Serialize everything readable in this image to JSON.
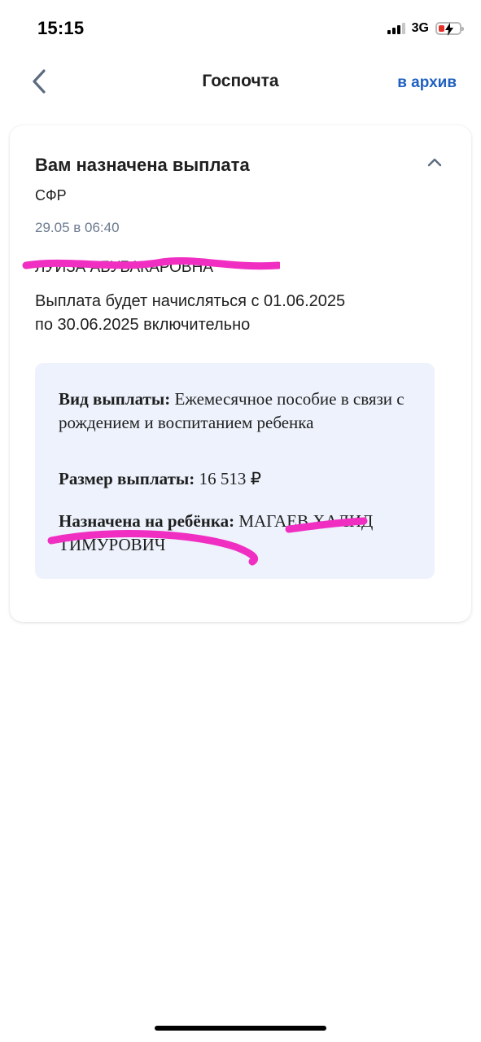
{
  "status_bar": {
    "time": "15:15",
    "network": "3G",
    "signal_bars": 4,
    "signal_bars_active": 3,
    "battery_level": 0.15,
    "battery_charging": true,
    "battery_color": "#e4322b"
  },
  "nav": {
    "back_icon": "chevron-left-icon",
    "title": "Госпочта",
    "archive_label": "в архив",
    "accent_color": "#1f5fbf"
  },
  "message": {
    "title": "Вам назначена выплата",
    "collapse_icon": "chevron-up-icon",
    "sender": "СФР",
    "datetime": "29.05 в 06:40",
    "recipient_name": "ЛУИЗА АБУБАКАРОВНА",
    "period_line1": "Выплата будет начисляться с 01.06.2025",
    "period_line2": "по 30.06.2025 включительно",
    "details": {
      "type_label": "Вид выплаты:",
      "type_value": "Ежемесячное пособие в связи с рождением и воспитанием ребенка",
      "amount_label": "Размер выплаты:",
      "amount_value": "16 513 ₽",
      "child_label": "Назначена на ребёнка:",
      "child_value": "МАГАЕВ ХАЛИД ТИМУРОВИЧ",
      "background": "#edf2fc"
    }
  }
}
